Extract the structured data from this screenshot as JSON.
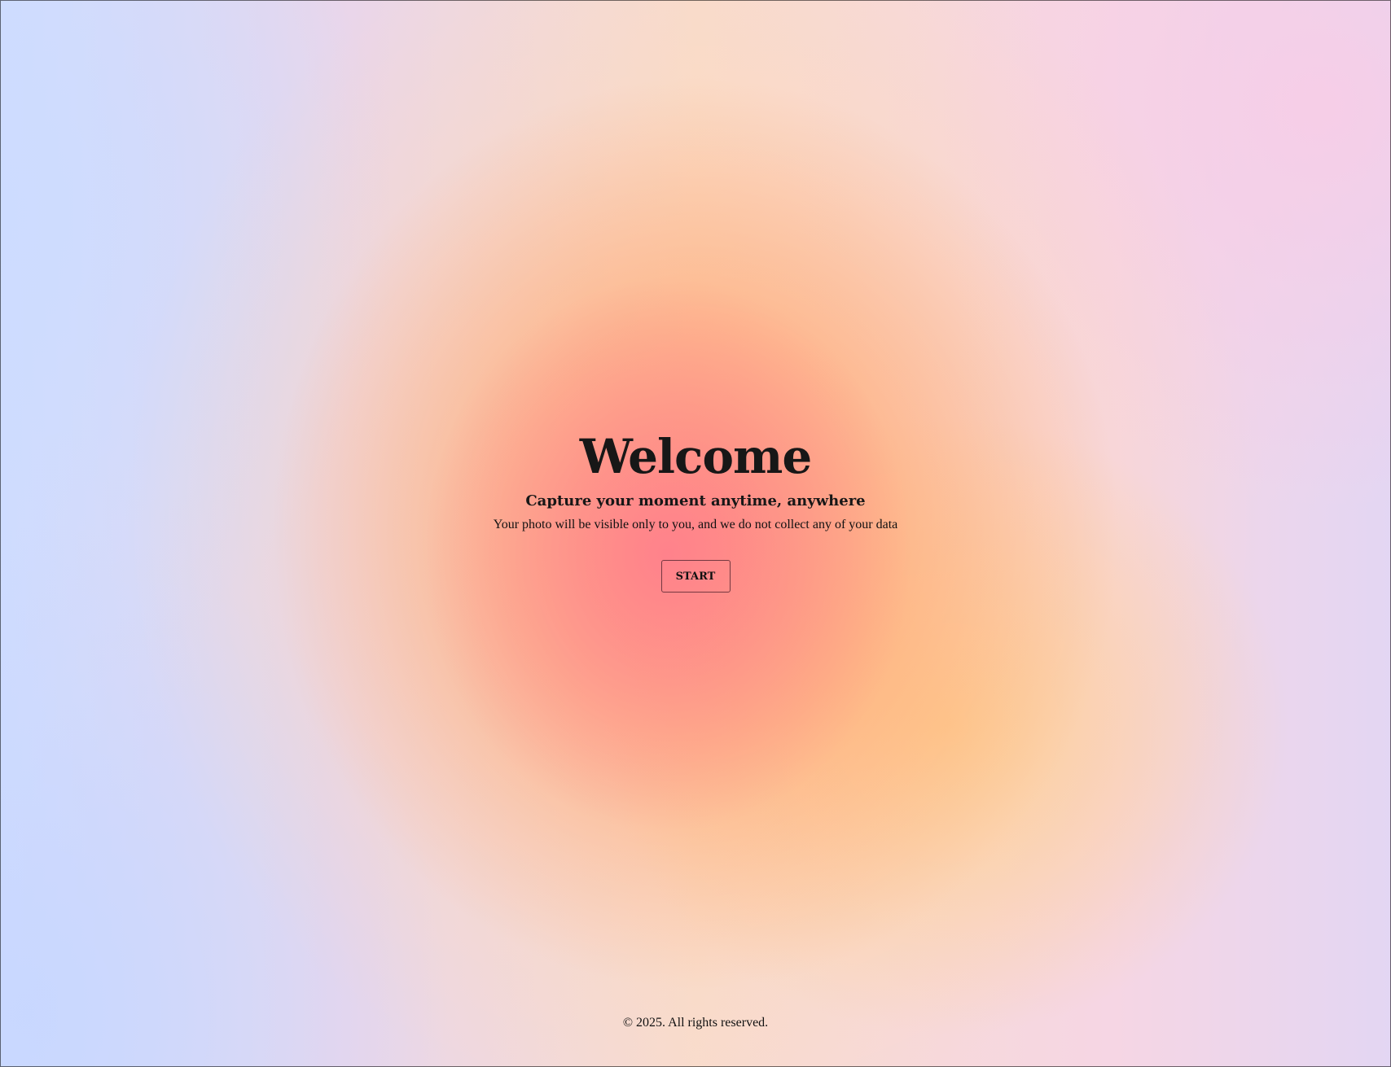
{
  "hero": {
    "title": "Welcome",
    "subtitle": "Capture your moment anytime, anywhere",
    "note": "Your photo will be visible only to you, and we do not collect any of your data",
    "start_label": "START"
  },
  "footer": {
    "copyright": "© 2025. All rights reserved."
  },
  "colors": {
    "text": "#111111",
    "gradient_center": "#ff8090",
    "gradient_mid": "#ffc890",
    "gradient_edge": "#cfdcff"
  }
}
